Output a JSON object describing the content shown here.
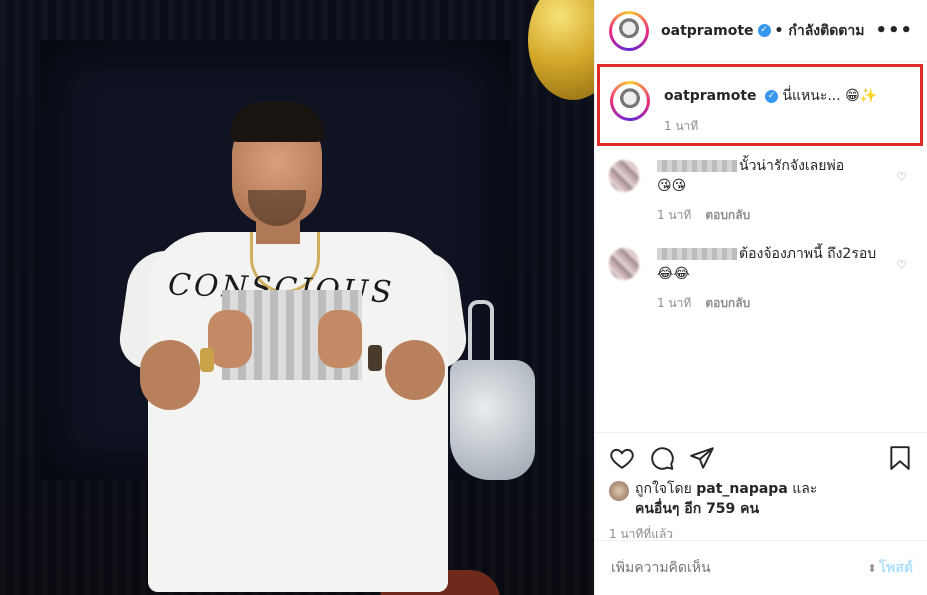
{
  "post": {
    "author": "oatpramote",
    "verified_mark": "✓",
    "follow_status": "• กำลังติดตาม",
    "more_icon": "more-horizontal-icon"
  },
  "photo": {
    "shirt_text": "CONSCIOUS"
  },
  "caption": {
    "username": "oatpramote",
    "text": "นี่แหนะ...",
    "emoji": "😁✨",
    "time": "1 นาที"
  },
  "comments": [
    {
      "text": "นั้วน่ารักจังเลยพ่อ",
      "emoji": "😘😘",
      "time": "1 นาที",
      "reply": "ตอบกลับ"
    },
    {
      "text": "ต้องจ้องภาพนี้ ถึง2รอบ",
      "emoji": "😂😂",
      "time": "1 นาที",
      "reply": "ตอบกลับ"
    }
  ],
  "actions": {
    "icons": [
      "heart-icon",
      "comment-icon",
      "share-icon",
      "bookmark-icon"
    ]
  },
  "likes": {
    "prefix": "ถูกใจโดย",
    "user": "pat_napapa",
    "and": "และ",
    "others": "คนอื่นๆ อีก 759 คน"
  },
  "posted_time": "1 นาทีที่แล้ว",
  "comment_box": {
    "placeholder": "เพิ่มความคิดเห็น",
    "post_label": "โพสต์"
  },
  "colors": {
    "highlight_border": "#e12b2b",
    "verified": "#3897f0",
    "post_button": "#b2dffc"
  }
}
